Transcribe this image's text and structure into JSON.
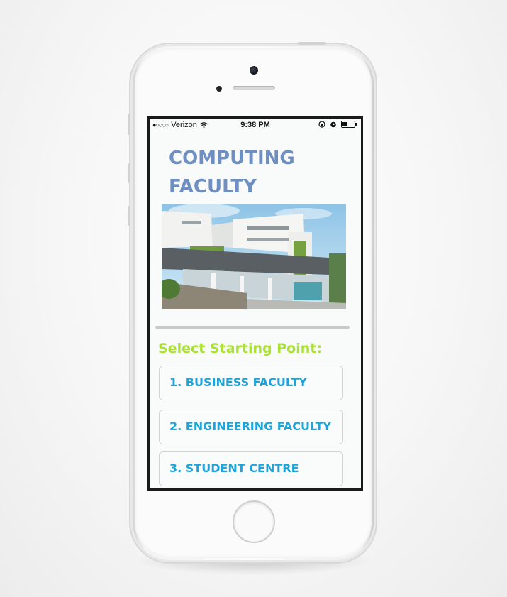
{
  "status_bar": {
    "signal_dots": "●○○○○",
    "carrier": "Verizon",
    "time": "9:38 PM",
    "icons": [
      "wifi-icon",
      "rotation-lock-icon",
      "alarm-icon",
      "battery-icon"
    ]
  },
  "page": {
    "title": "COMPUTING FACULTY",
    "photo_description_icon": "building-photo",
    "select_label": "Select Starting Point:"
  },
  "options": [
    {
      "label": "1. BUSINESS FACULTY"
    },
    {
      "label": "2. ENGINEERING FACULTY"
    },
    {
      "label": "3. STUDENT CENTRE"
    }
  ],
  "colors": {
    "title": "#6f8fc2",
    "select_label": "#a9e134",
    "option_text": "#1ea4d8"
  }
}
